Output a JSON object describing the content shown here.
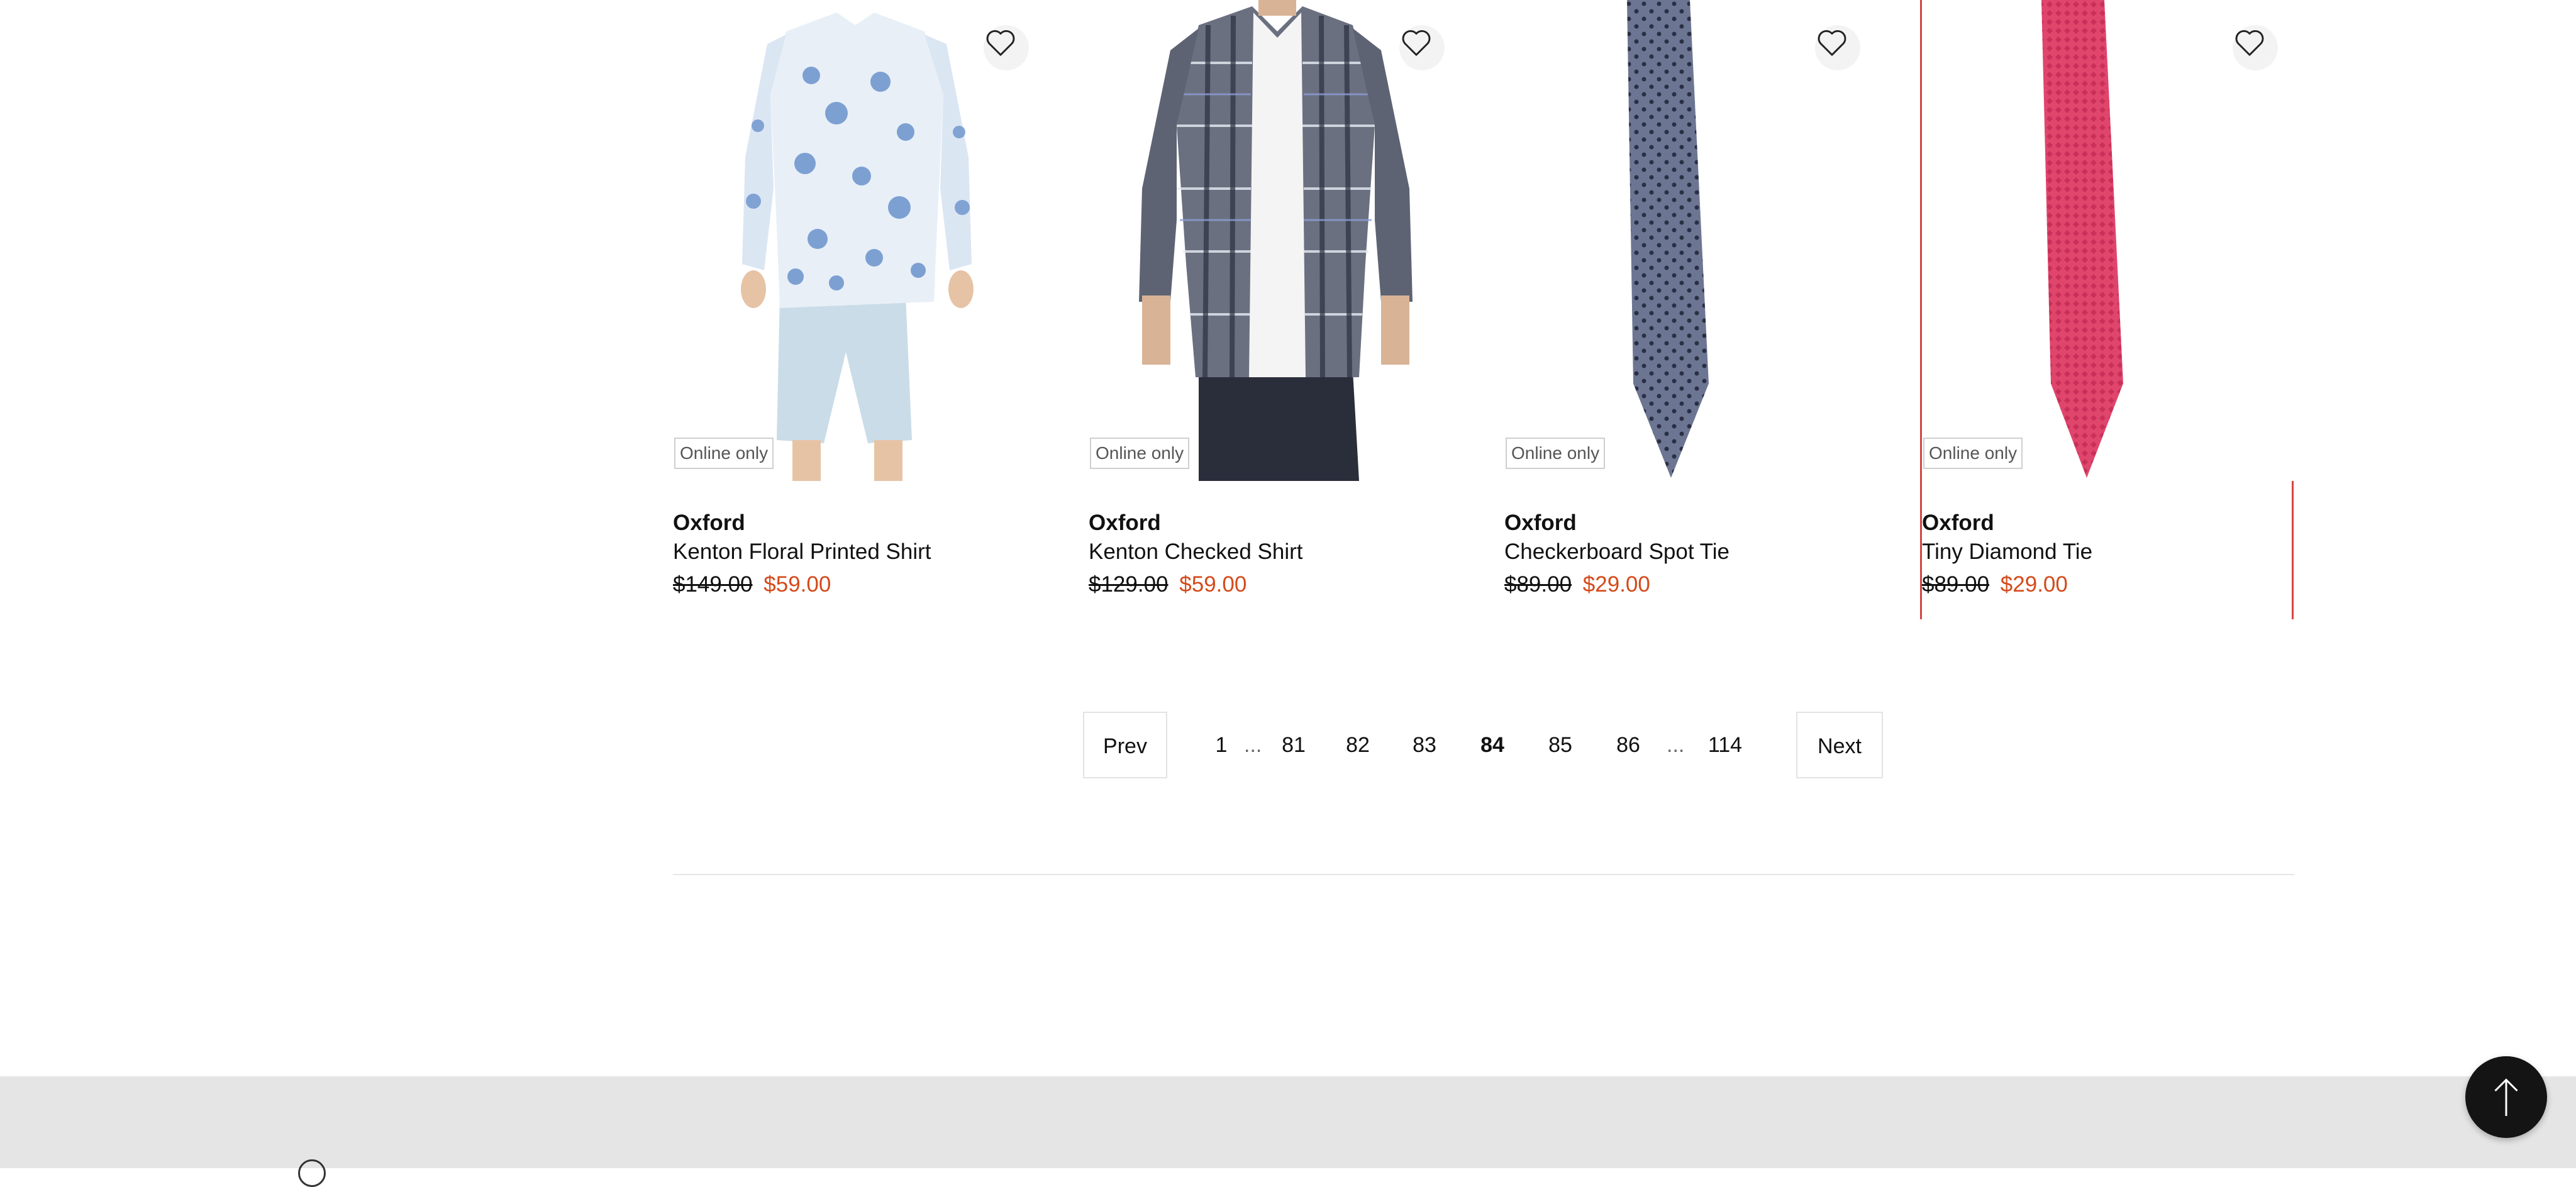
{
  "products": [
    {
      "brand": "Oxford",
      "name": "Kenton Floral Printed Shirt",
      "original_price": "$149.00",
      "sale_price": "$59.00",
      "badge": "Online only",
      "image_icon": "shirt-floral-image",
      "wishlist_icon": "heart-icon"
    },
    {
      "brand": "Oxford",
      "name": "Kenton Checked Shirt",
      "original_price": "$129.00",
      "sale_price": "$59.00",
      "badge": "Online only",
      "image_icon": "shirt-checked-image",
      "wishlist_icon": "heart-icon"
    },
    {
      "brand": "Oxford",
      "name": "Checkerboard Spot Tie",
      "original_price": "$89.00",
      "sale_price": "$29.00",
      "badge": "Online only",
      "image_icon": "tie-blue-image",
      "wishlist_icon": "heart-icon"
    },
    {
      "brand": "Oxford",
      "name": "Tiny Diamond Tie",
      "original_price": "$89.00",
      "sale_price": "$29.00",
      "badge": "Online only",
      "image_icon": "tie-red-image",
      "wishlist_icon": "heart-icon"
    }
  ],
  "pagination": {
    "prev_label": "Prev",
    "next_label": "Next",
    "pages": [
      "1",
      "81",
      "82",
      "83",
      "84",
      "85",
      "86",
      "114"
    ],
    "current": "84",
    "ellipsis": "..."
  },
  "colors": {
    "sale_price": "#d44a1a",
    "hover_border": "#d64545",
    "footer_bg": "#e5e5e5",
    "back_to_top_bg": "#141414"
  },
  "back_to_top_icon": "arrow-up-icon"
}
